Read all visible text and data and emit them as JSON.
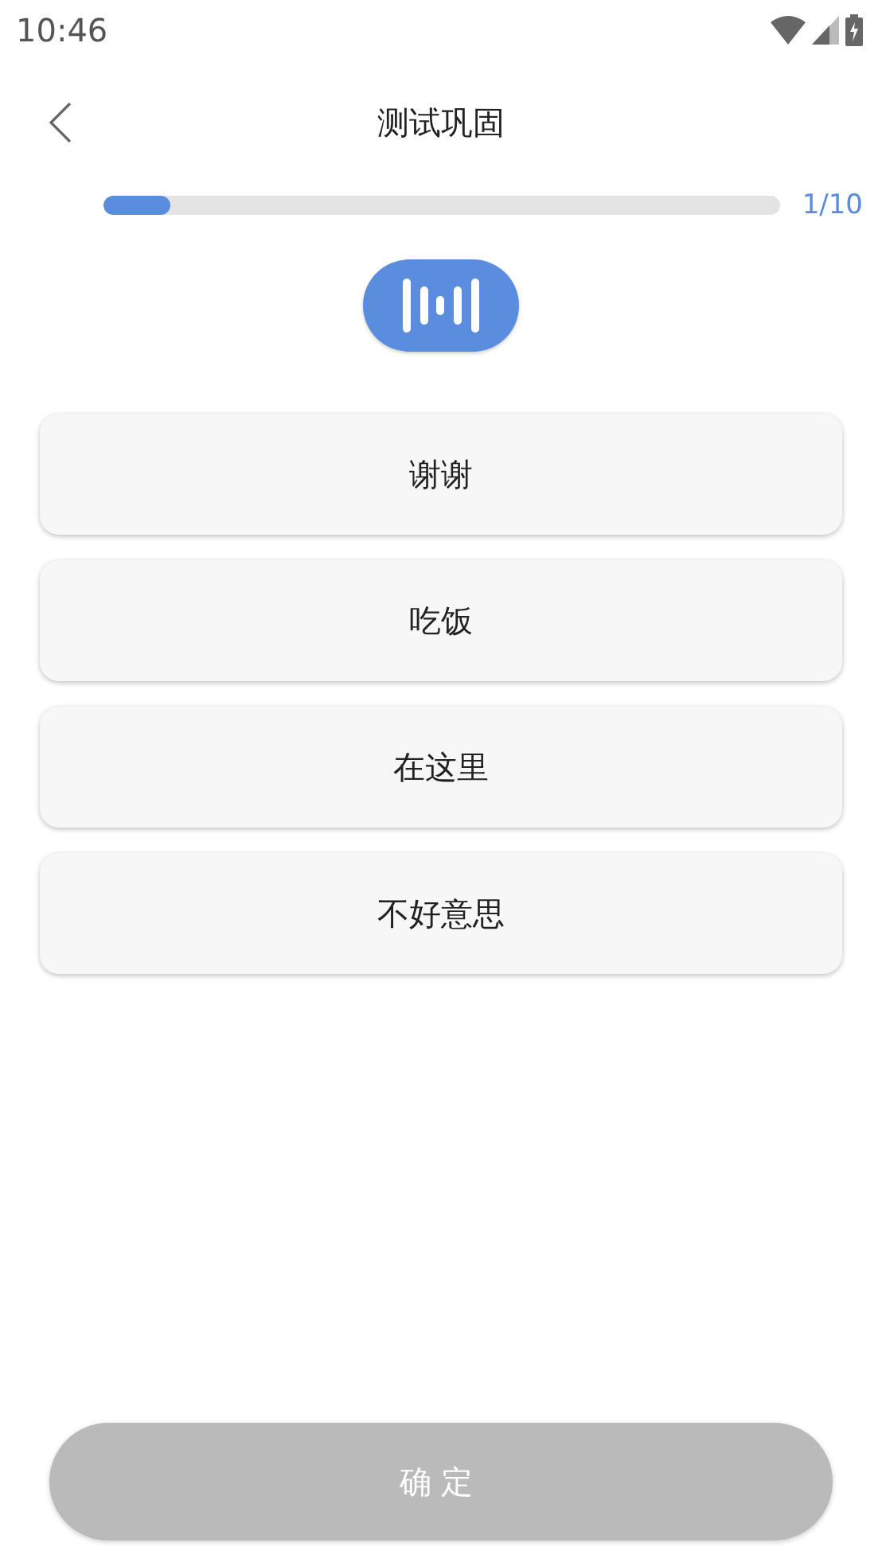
{
  "status_bar": {
    "time": "10:46"
  },
  "header": {
    "title": "测试巩固"
  },
  "progress": {
    "level": 0.1,
    "reading": "1/10"
  },
  "options": [
    {
      "label": "谢谢",
      "selected": false
    },
    {
      "label": "吃饭",
      "selected": false
    },
    {
      "label": "在这里",
      "selected": false
    },
    {
      "label": "不好意思",
      "selected": false
    }
  ],
  "confirm_button": {
    "label": "确定",
    "disabled": true
  }
}
